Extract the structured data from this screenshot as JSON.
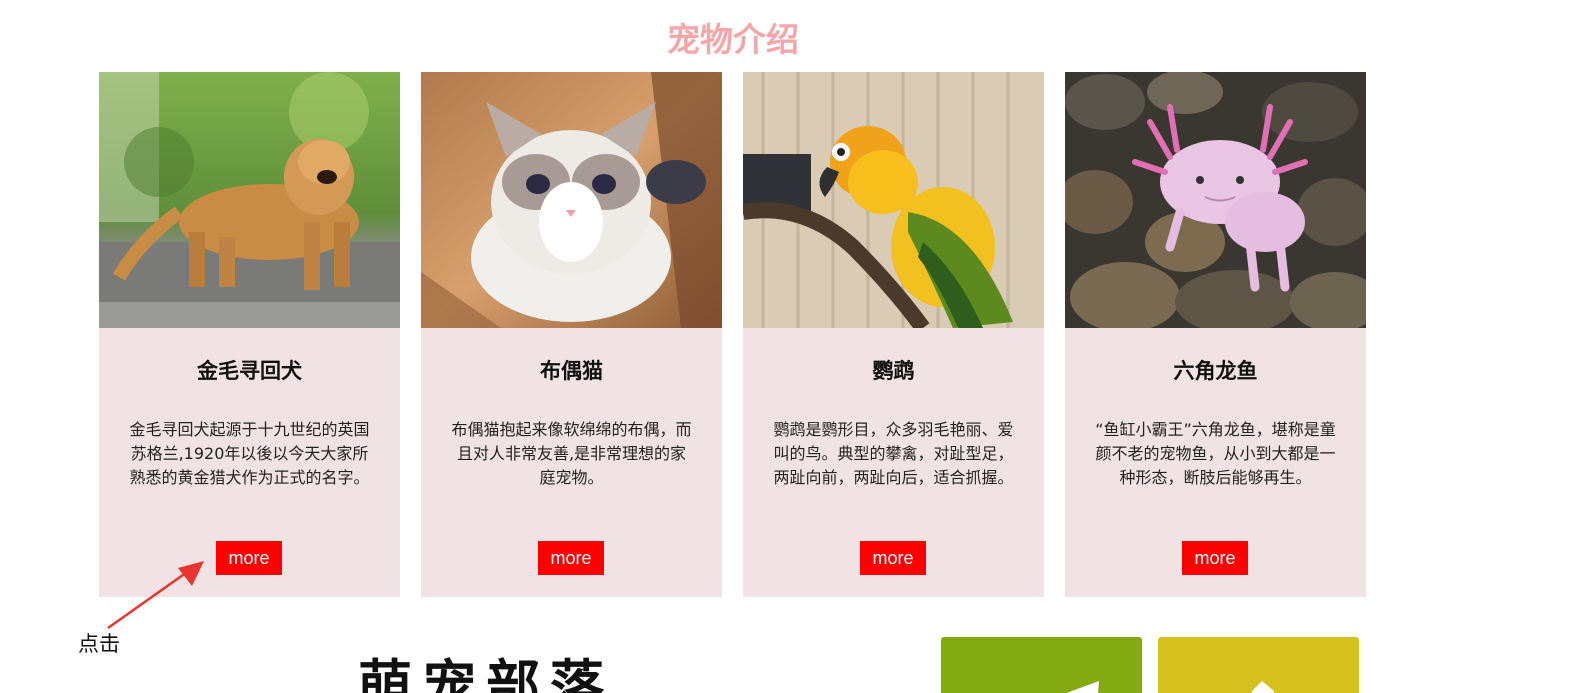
{
  "section": {
    "title": "宠物介绍"
  },
  "pets": [
    {
      "name": "金毛寻回犬",
      "description": "金毛寻回犬起源于十九世纪的英国苏格兰,1920年以後以今天大家所熟悉的黄金猎犬作为正式的名字。",
      "more_label": "more",
      "image": "golden-retriever-photo"
    },
    {
      "name": "布偶猫",
      "description": "布偶猫抱起来像软绵绵的布偶，而且对人非常友善,是非常理想的家庭宠物。",
      "more_label": "more",
      "image": "ragdoll-cat-photo"
    },
    {
      "name": "鹦鹉",
      "description": "鹦鹉是鹦形目，众多羽毛艳丽、爱叫的鸟。典型的攀禽，对趾型足，两趾向前，两趾向后，适合抓握。",
      "more_label": "more",
      "image": "parrot-photo"
    },
    {
      "name": "六角龙鱼",
      "description": "“鱼缸小霸王”六角龙鱼，堪称是童颜不老的宠物鱼，从小到大都是一种形态，断肢后能够再生。",
      "more_label": "more",
      "image": "axolotl-photo"
    }
  ],
  "annotation": {
    "label": "点击"
  },
  "tribe": {
    "title": "萌宠部落"
  },
  "colors": {
    "title": "#f4a6a8",
    "card_bg": "#f1e3e3",
    "button": "#ff0000",
    "tile_green": "#84aa12",
    "tile_yellow": "#d5c01d",
    "arrow": "#e8352f"
  }
}
